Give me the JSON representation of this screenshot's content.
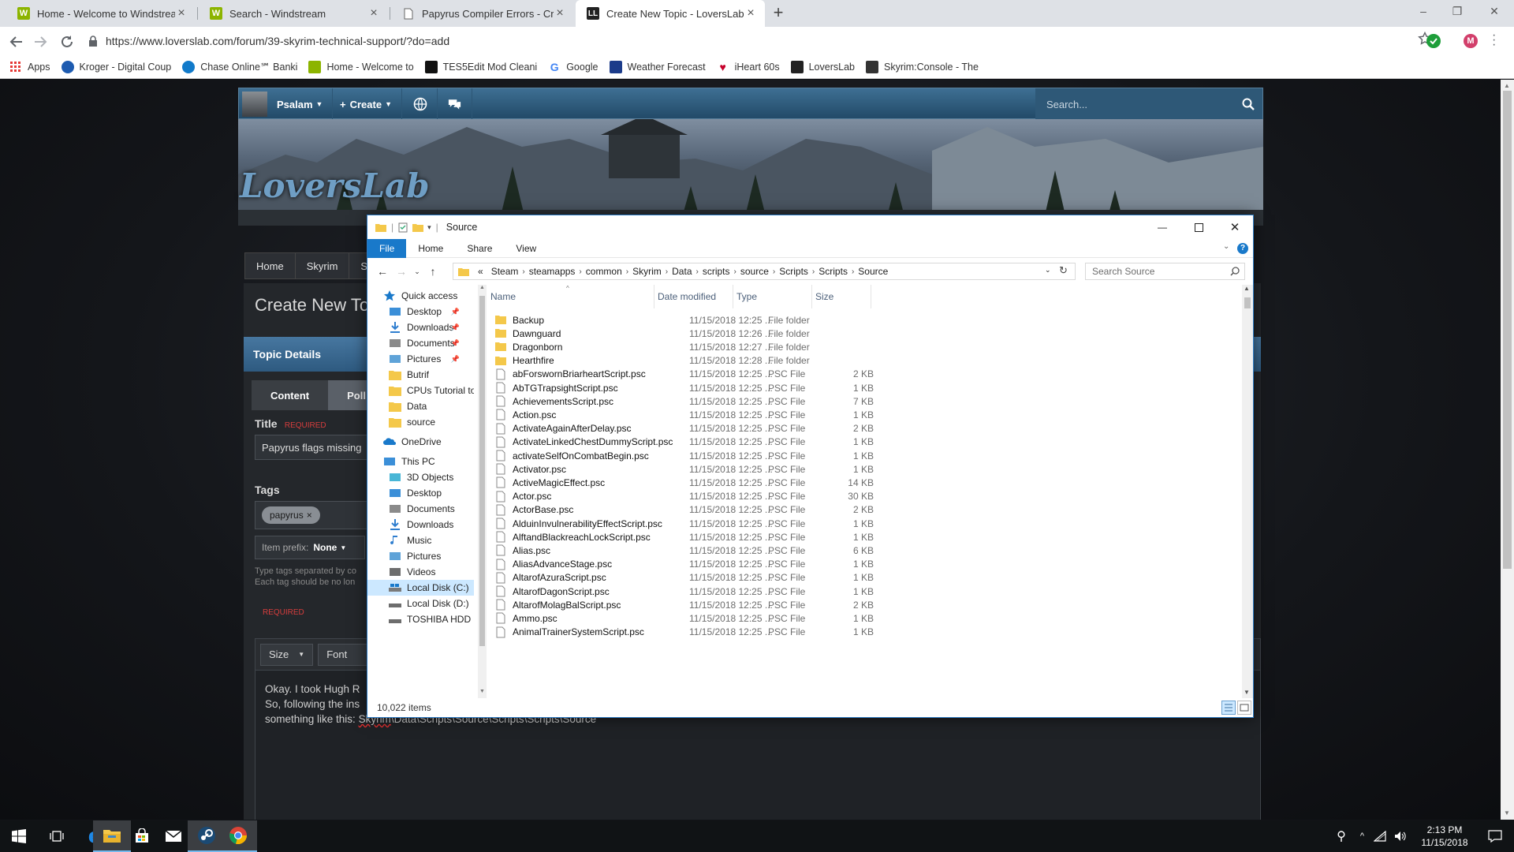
{
  "browser": {
    "tabs": [
      {
        "title": "Home - Welcome to Windstream",
        "active": false
      },
      {
        "title": "Search - Windstream",
        "active": false
      },
      {
        "title": "Papyrus Compiler Errors - Creatio",
        "active": false
      },
      {
        "title": "Create New Topic - LoversLab",
        "active": true
      }
    ],
    "url": "https://www.loverslab.com/forum/39-skyrim-technical-support/?do=add",
    "profile_initial": "M",
    "bookmarks": [
      {
        "label": "Apps",
        "icon": "apps-grid-icon",
        "color": "#d93025"
      },
      {
        "label": "Kroger - Digital Coup",
        "icon": "kroger-icon",
        "color": "#1d5bb0"
      },
      {
        "label": "Chase Online℠ Banki",
        "icon": "chase-icon",
        "color": "#117aca"
      },
      {
        "label": "Home - Welcome to",
        "icon": "windstream-icon",
        "color": "#8cb400"
      },
      {
        "label": "TES5Edit Mod Cleani",
        "icon": "tes5edit-icon",
        "color": "#111111"
      },
      {
        "label": "Google",
        "icon": "google-icon",
        "color": "#4285f4"
      },
      {
        "label": "Weather Forecast",
        "icon": "weather-icon",
        "color": "#1b3b8a"
      },
      {
        "label": "iHeart 60s",
        "icon": "iheart-icon",
        "color": "#c6002b"
      },
      {
        "label": "LoversLab",
        "icon": "loverslab-icon",
        "color": "#222222"
      },
      {
        "label": "Skyrim:Console - The",
        "icon": "skyrim-icon",
        "color": "#333333"
      }
    ]
  },
  "site": {
    "nav": {
      "user": "Psalam",
      "create": "Create",
      "search_placeholder": "Search..."
    },
    "logo": "LoversLab",
    "breadcrumbs": [
      "Home",
      "Skyrim",
      "Sky"
    ],
    "page_title": "Create New To",
    "section_header": "Topic Details",
    "tabs": [
      "Content",
      "Poll"
    ],
    "title_label": "Title",
    "required": "REQUIRED",
    "title_value": "Papyrus flags missing",
    "tags_label": "Tags",
    "tag": "papyrus",
    "item_prefix_label": "Item prefix:",
    "item_prefix_value": "None",
    "tags_hint_1": "Type tags separated by co",
    "tags_hint_2": "Each tag should be no lon",
    "editor_required": "REQUIRED",
    "editor_size": "Size",
    "editor_font": "Font",
    "editor_line1": "Okay. I took Hugh R",
    "editor_line2": "So, following the ins",
    "editor_line3_prefix": "something like this: ",
    "editor_line3_underlined": "Skyrim",
    "editor_line3_rest": "\\Data\\Scripts\\Source\\Scripts\\Scripts\\Source"
  },
  "explorer": {
    "window_title": "Source",
    "ribbon_tabs": [
      "File",
      "Home",
      "Share",
      "View"
    ],
    "path": [
      "«",
      "Steam",
      "steamapps",
      "common",
      "Skyrim",
      "Data",
      "scripts",
      "source",
      "Scripts",
      "Scripts",
      "Source"
    ],
    "search_placeholder": "Search Source",
    "columns": {
      "name": "Name",
      "date": "Date modified",
      "type": "Type",
      "size": "Size"
    },
    "nav_items": [
      {
        "label": "Quick access",
        "icon": "star-icon",
        "pinned": false,
        "indent": 0
      },
      {
        "label": "Desktop",
        "icon": "desktop-icon",
        "pinned": true,
        "indent": 1
      },
      {
        "label": "Downloads",
        "icon": "download-icon",
        "pinned": true,
        "indent": 1
      },
      {
        "label": "Documents",
        "icon": "documents-icon",
        "pinned": true,
        "indent": 1
      },
      {
        "label": "Pictures",
        "icon": "pictures-icon",
        "pinned": true,
        "indent": 1
      },
      {
        "label": "Butrif",
        "icon": "folder-icon",
        "pinned": false,
        "indent": 1
      },
      {
        "label": "CPUs Tutorial to",
        "icon": "folder-icon",
        "pinned": false,
        "indent": 1
      },
      {
        "label": "Data",
        "icon": "folder-icon",
        "pinned": false,
        "indent": 1
      },
      {
        "label": "source",
        "icon": "folder-icon",
        "pinned": false,
        "indent": 1
      },
      {
        "label": "OneDrive",
        "icon": "onedrive-icon",
        "pinned": false,
        "indent": 0
      },
      {
        "label": "This PC",
        "icon": "pc-icon",
        "pinned": false,
        "indent": 0
      },
      {
        "label": "3D Objects",
        "icon": "objects3d-icon",
        "pinned": false,
        "indent": 1
      },
      {
        "label": "Desktop",
        "icon": "desktop-icon",
        "pinned": false,
        "indent": 1
      },
      {
        "label": "Documents",
        "icon": "documents-icon",
        "pinned": false,
        "indent": 1
      },
      {
        "label": "Downloads",
        "icon": "download-icon",
        "pinned": false,
        "indent": 1
      },
      {
        "label": "Music",
        "icon": "music-icon",
        "pinned": false,
        "indent": 1
      },
      {
        "label": "Pictures",
        "icon": "pictures-icon",
        "pinned": false,
        "indent": 1
      },
      {
        "label": "Videos",
        "icon": "videos-icon",
        "pinned": false,
        "indent": 1
      },
      {
        "label": "Local Disk (C:)",
        "icon": "drive-c-icon",
        "pinned": false,
        "indent": 1,
        "selected": true
      },
      {
        "label": "Local Disk (D:)",
        "icon": "drive-icon",
        "pinned": false,
        "indent": 1
      },
      {
        "label": "TOSHIBA HDD (I",
        "icon": "drive-icon",
        "pinned": false,
        "indent": 1
      }
    ],
    "files": [
      {
        "name": "Backup",
        "date": "11/15/2018 12:25 ...",
        "type": "File folder",
        "size": "",
        "folder": true
      },
      {
        "name": "Dawnguard",
        "date": "11/15/2018 12:26 ...",
        "type": "File folder",
        "size": "",
        "folder": true
      },
      {
        "name": "Dragonborn",
        "date": "11/15/2018 12:27 ...",
        "type": "File folder",
        "size": "",
        "folder": true
      },
      {
        "name": "Hearthfire",
        "date": "11/15/2018 12:28 ...",
        "type": "File folder",
        "size": "",
        "folder": true
      },
      {
        "name": "abForswornBriarheartScript.psc",
        "date": "11/15/2018 12:25 ...",
        "type": "PSC File",
        "size": "2 KB"
      },
      {
        "name": "AbTGTrapsightScript.psc",
        "date": "11/15/2018 12:25 ...",
        "type": "PSC File",
        "size": "1 KB"
      },
      {
        "name": "AchievementsScript.psc",
        "date": "11/15/2018 12:25 ...",
        "type": "PSC File",
        "size": "7 KB"
      },
      {
        "name": "Action.psc",
        "date": "11/15/2018 12:25 ...",
        "type": "PSC File",
        "size": "1 KB"
      },
      {
        "name": "ActivateAgainAfterDelay.psc",
        "date": "11/15/2018 12:25 ...",
        "type": "PSC File",
        "size": "2 KB"
      },
      {
        "name": "ActivateLinkedChestDummyScript.psc",
        "date": "11/15/2018 12:25 ...",
        "type": "PSC File",
        "size": "1 KB"
      },
      {
        "name": "activateSelfOnCombatBegin.psc",
        "date": "11/15/2018 12:25 ...",
        "type": "PSC File",
        "size": "1 KB"
      },
      {
        "name": "Activator.psc",
        "date": "11/15/2018 12:25 ...",
        "type": "PSC File",
        "size": "1 KB"
      },
      {
        "name": "ActiveMagicEffect.psc",
        "date": "11/15/2018 12:25 ...",
        "type": "PSC File",
        "size": "14 KB"
      },
      {
        "name": "Actor.psc",
        "date": "11/15/2018 12:25 ...",
        "type": "PSC File",
        "size": "30 KB"
      },
      {
        "name": "ActorBase.psc",
        "date": "11/15/2018 12:25 ...",
        "type": "PSC File",
        "size": "2 KB"
      },
      {
        "name": "AlduinInvulnerabilityEffectScript.psc",
        "date": "11/15/2018 12:25 ...",
        "type": "PSC File",
        "size": "1 KB"
      },
      {
        "name": "AlftandBlackreachLockScript.psc",
        "date": "11/15/2018 12:25 ...",
        "type": "PSC File",
        "size": "1 KB"
      },
      {
        "name": "Alias.psc",
        "date": "11/15/2018 12:25 ...",
        "type": "PSC File",
        "size": "6 KB"
      },
      {
        "name": "AliasAdvanceStage.psc",
        "date": "11/15/2018 12:25 ...",
        "type": "PSC File",
        "size": "1 KB"
      },
      {
        "name": "AltarofAzuraScript.psc",
        "date": "11/15/2018 12:25 ...",
        "type": "PSC File",
        "size": "1 KB"
      },
      {
        "name": "AltarofDagonScript.psc",
        "date": "11/15/2018 12:25 ...",
        "type": "PSC File",
        "size": "1 KB"
      },
      {
        "name": "AltarofMolagBalScript.psc",
        "date": "11/15/2018 12:25 ...",
        "type": "PSC File",
        "size": "2 KB"
      },
      {
        "name": "Ammo.psc",
        "date": "11/15/2018 12:25 ...",
        "type": "PSC File",
        "size": "1 KB"
      },
      {
        "name": "AnimalTrainerSystemScript.psc",
        "date": "11/15/2018 12:25 ...",
        "type": "PSC File",
        "size": "1 KB"
      }
    ],
    "status": "10,022 items"
  },
  "taskbar": {
    "apps": [
      "start-icon",
      "task-view-icon",
      "edge-icon",
      "file-explorer-icon",
      "store-icon",
      "mail-icon",
      "steam-icon",
      "chrome-icon"
    ],
    "time": "2:13 PM",
    "date": "11/15/2018"
  }
}
